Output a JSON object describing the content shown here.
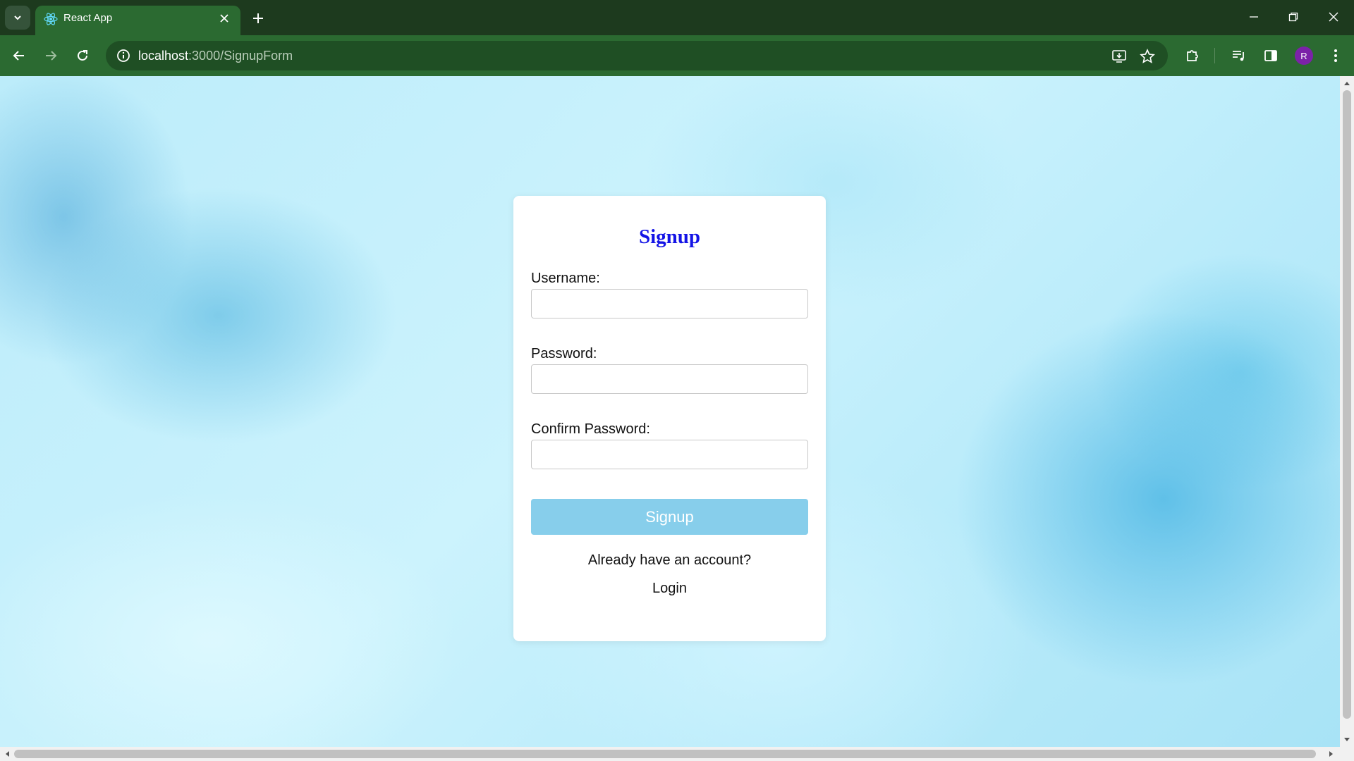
{
  "browser": {
    "tab": {
      "title": "React App",
      "favicon": "react-logo-icon"
    },
    "url": {
      "host": "localhost",
      "path": ":3000/SignupForm"
    },
    "profile_initial": "R",
    "accent_color": "#2b6a31"
  },
  "form": {
    "title": "Signup",
    "title_color": "#1414e6",
    "username_label": "Username:",
    "username_value": "",
    "password_label": "Password:",
    "password_value": "",
    "confirm_label": "Confirm Password:",
    "confirm_value": "",
    "submit_label": "Signup",
    "submit_color": "#87ceeb",
    "already_text": "Already have an account?",
    "login_link": "Login"
  }
}
